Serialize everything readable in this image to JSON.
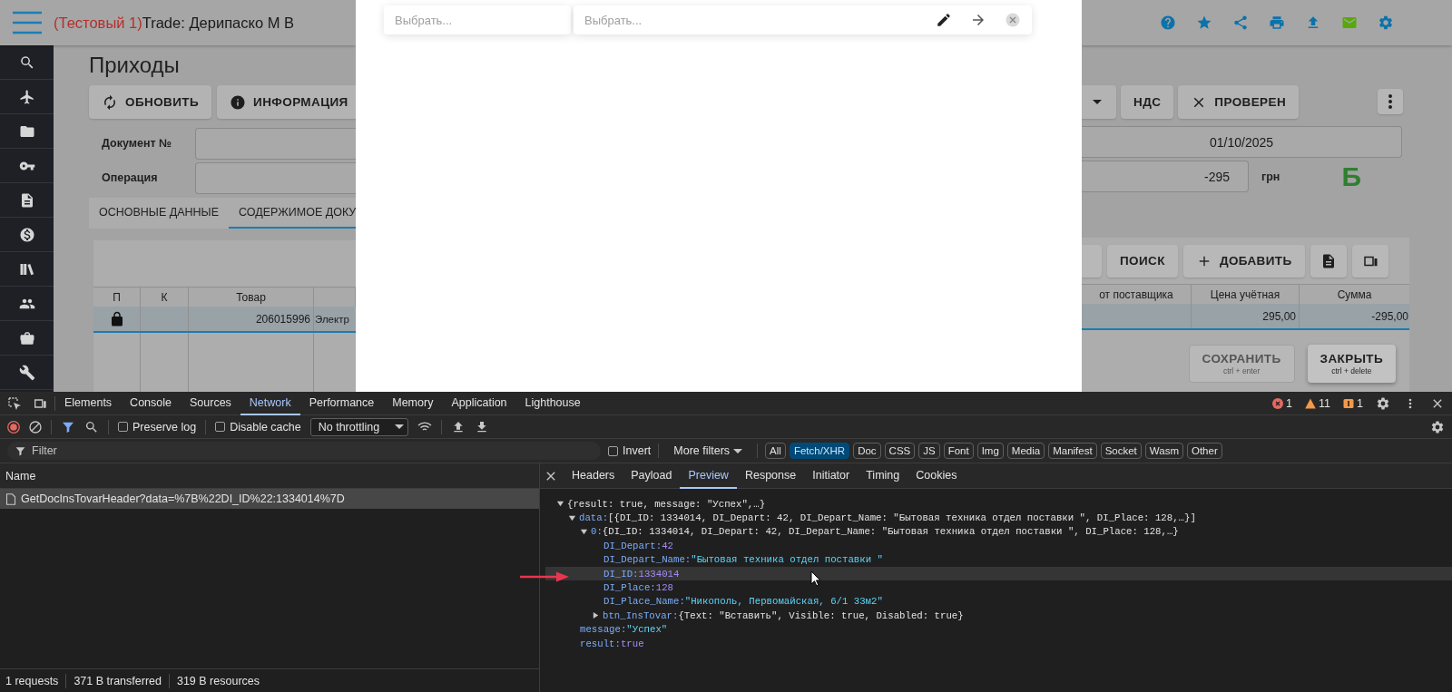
{
  "app": {
    "title_prefix": "(Тестовый 1)",
    "title": "Trade: Дерипаско М В",
    "page_title": "Приходы",
    "actions_left": [
      {
        "label": "ОБНОВИТЬ"
      },
      {
        "label": "ИНФОРМАЦИЯ"
      }
    ],
    "actions_right": [
      {
        "label": "НДС"
      },
      {
        "label": "ПРОВЕРЕН"
      }
    ],
    "field_labels": [
      "Документ №",
      "Операция"
    ],
    "date": "01/10/2025",
    "amount": "-295",
    "currency": "грн",
    "badge": "Б",
    "tabs": [
      {
        "label": "ОСНОВНЫЕ ДАННЫЕ",
        "selected": false
      },
      {
        "label": "СОДЕРЖИМОЕ ДОКУ",
        "selected": true
      }
    ],
    "grid_buttons": [
      "ПОИСК",
      "ДОБАВИТЬ"
    ],
    "columns_left": [
      "П",
      "К",
      "Товар"
    ],
    "columns_right": [
      "от поставщика",
      "Цена учётная",
      "Сумма"
    ],
    "rows": [
      {
        "selected": true,
        "locked": true,
        "code": "206015996",
        "name": "Электр",
        "price": "295,00",
        "sum": "-295,00"
      }
    ],
    "form_buttons": [
      {
        "label": "СОХРАНИТЬ",
        "hint": "ctrl + enter",
        "disabled": true
      },
      {
        "label": "ЗАКРЫТЬ",
        "hint": "ctrl + delete",
        "disabled": false
      }
    ]
  },
  "modal": {
    "selects": [
      {
        "placeholder": "Выбрать..."
      },
      {
        "placeholder": "Выбрать..."
      }
    ]
  },
  "devtools": {
    "panels": [
      {
        "label": "Elements",
        "selected": false
      },
      {
        "label": "Console",
        "selected": false
      },
      {
        "label": "Sources",
        "selected": false
      },
      {
        "label": "Network",
        "selected": true
      },
      {
        "label": "Performance",
        "selected": false
      },
      {
        "label": "Memory",
        "selected": false
      },
      {
        "label": "Application",
        "selected": false
      },
      {
        "label": "Lighthouse",
        "selected": false
      }
    ],
    "issues": {
      "errors": "1",
      "warnings": "11",
      "infos": "1"
    },
    "options": [
      {
        "label": "Preserve log",
        "checked": false
      },
      {
        "label": "Disable cache",
        "checked": false
      }
    ],
    "throttling": "No throttling",
    "filter": {
      "placeholder": "Filter"
    },
    "invert": {
      "label": "Invert",
      "checked": false
    },
    "more_filters": "More filters",
    "types": [
      {
        "label": "All",
        "selected": false
      },
      {
        "label": "Fetch/XHR",
        "selected": true
      },
      {
        "label": "Doc",
        "selected": false
      },
      {
        "label": "CSS",
        "selected": false
      },
      {
        "label": "JS",
        "selected": false
      },
      {
        "label": "Font",
        "selected": false
      },
      {
        "label": "Img",
        "selected": false
      },
      {
        "label": "Media",
        "selected": false
      },
      {
        "label": "Manifest",
        "selected": false
      },
      {
        "label": "Socket",
        "selected": false
      },
      {
        "label": "Wasm",
        "selected": false
      },
      {
        "label": "Other",
        "selected": false
      }
    ],
    "name_header": "Name",
    "requests": [
      {
        "name": "GetDocInsTovarHeader?data=%7B%22DI_ID%22:1334014%7D",
        "selected": true
      }
    ],
    "status": [
      "1 requests",
      "371 B transferred",
      "319 B resources"
    ],
    "detail_tabs": [
      {
        "label": "Headers",
        "selected": false
      },
      {
        "label": "Payload",
        "selected": false
      },
      {
        "label": "Preview",
        "selected": true
      },
      {
        "label": "Response",
        "selected": false
      },
      {
        "label": "Initiator",
        "selected": false
      },
      {
        "label": "Timing",
        "selected": false
      },
      {
        "label": "Cookies",
        "selected": false
      }
    ],
    "preview": {
      "kind": "object",
      "summary": "{result: true, message: \"Успех\",…}",
      "expanded": true,
      "highlighted": false,
      "children": [
        {
          "kind": "object",
          "key": "data:",
          "summary": "[{DI_ID: 1334014, DI_Depart: 42, DI_Depart_Name: \"Бытовая техника отдел поставки \", DI_Place: 128,…}]",
          "expanded": true,
          "highlighted": false,
          "children": [
            {
              "kind": "object",
              "key": "0:",
              "summary": "{DI_ID: 1334014, DI_Depart: 42, DI_Depart_Name: \"Бытовая техника отдел поставки \", DI_Place: 128,…}",
              "expanded": true,
              "highlighted": false,
              "children": [
                {
                  "kind": "number",
                  "key": "DI_Depart:",
                  "value": "42",
                  "highlighted": false
                },
                {
                  "kind": "string",
                  "key": "DI_Depart_Name:",
                  "value": "\"Бытовая техника отдел поставки \"",
                  "highlighted": false
                },
                {
                  "kind": "number",
                  "key": "DI_ID:",
                  "value": "1334014",
                  "highlighted": true
                },
                {
                  "kind": "number",
                  "key": "DI_Place:",
                  "value": "128",
                  "highlighted": false
                },
                {
                  "kind": "string",
                  "key": "DI_Place_Name:",
                  "value": "\"Никополь, Первомайская, 6/1 33м2\"",
                  "highlighted": false
                },
                {
                  "kind": "object",
                  "key": "btn_InsTovar:",
                  "summary": "{Text: \"Вставить\", Visible: true, Disabled: true}",
                  "expanded": false,
                  "highlighted": false
                }
              ]
            }
          ]
        },
        {
          "kind": "string",
          "key": "message:",
          "value": "\"Успех\"",
          "highlighted": false
        },
        {
          "kind": "bool",
          "key": "result:",
          "value": "true",
          "highlighted": false
        }
      ]
    }
  }
}
